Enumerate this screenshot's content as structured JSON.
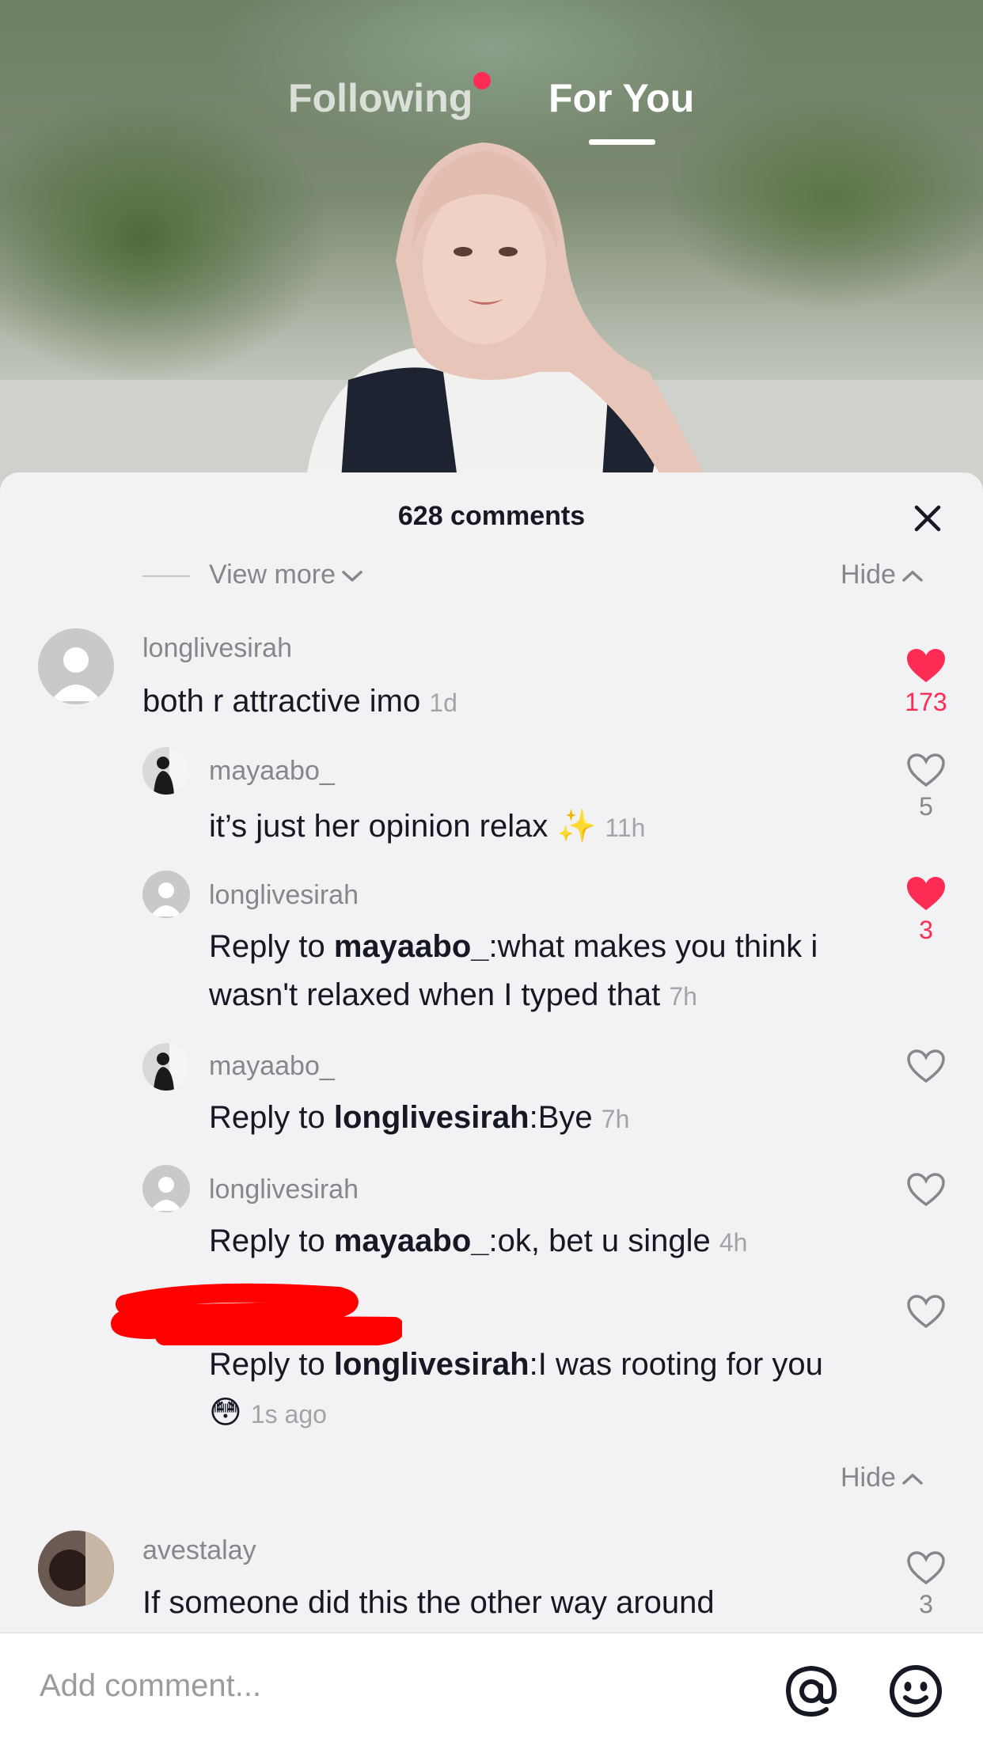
{
  "nav": {
    "following": "Following",
    "for_you": "For You"
  },
  "comments": {
    "count_title": "628 comments",
    "view_more": "View more",
    "hide_label": "Hide",
    "items": [
      {
        "user": "longlivesirah",
        "text": "both r attractive imo",
        "time": "1d",
        "likes": "173",
        "liked": true
      },
      {
        "user": "mayaabo_",
        "text": "it’s just her opinion relax ✨",
        "time": "11h",
        "likes": "5",
        "liked": false
      },
      {
        "user": "longlivesirah",
        "reply_prefix": "Reply to ",
        "reply_to": "mayaabo_",
        "text": ":what makes you think i wasn't relaxed when I typed that",
        "time": "7h",
        "likes": "3",
        "liked": true
      },
      {
        "user": "mayaabo_",
        "reply_prefix": "Reply to ",
        "reply_to": "longlivesirah",
        "text": ":Bye",
        "time": "7h",
        "likes": "",
        "liked": false
      },
      {
        "user": "longlivesirah",
        "reply_prefix": "Reply to ",
        "reply_to": "mayaabo_",
        "text": ":ok, bet u single",
        "time": "4h",
        "likes": "",
        "liked": false
      },
      {
        "user": "",
        "reply_prefix": "Reply to ",
        "reply_to": "longlivesirah",
        "text": ":I was rooting for you",
        "emoji": "😳",
        "time": "1s ago",
        "likes": "",
        "liked": false
      },
      {
        "user": "avestalay",
        "text": "If someone did this the other way around",
        "likes": "3",
        "liked": false
      }
    ]
  },
  "input": {
    "placeholder": "Add comment..."
  },
  "icons": {
    "close": "close-icon",
    "mention": "at-icon",
    "emoji": "emoji-icon",
    "heart": "heart-icon"
  },
  "colors": {
    "accent": "#fe2c55",
    "sheet": "#f2f2f4",
    "text": "#161823",
    "muted": "#86878b"
  }
}
